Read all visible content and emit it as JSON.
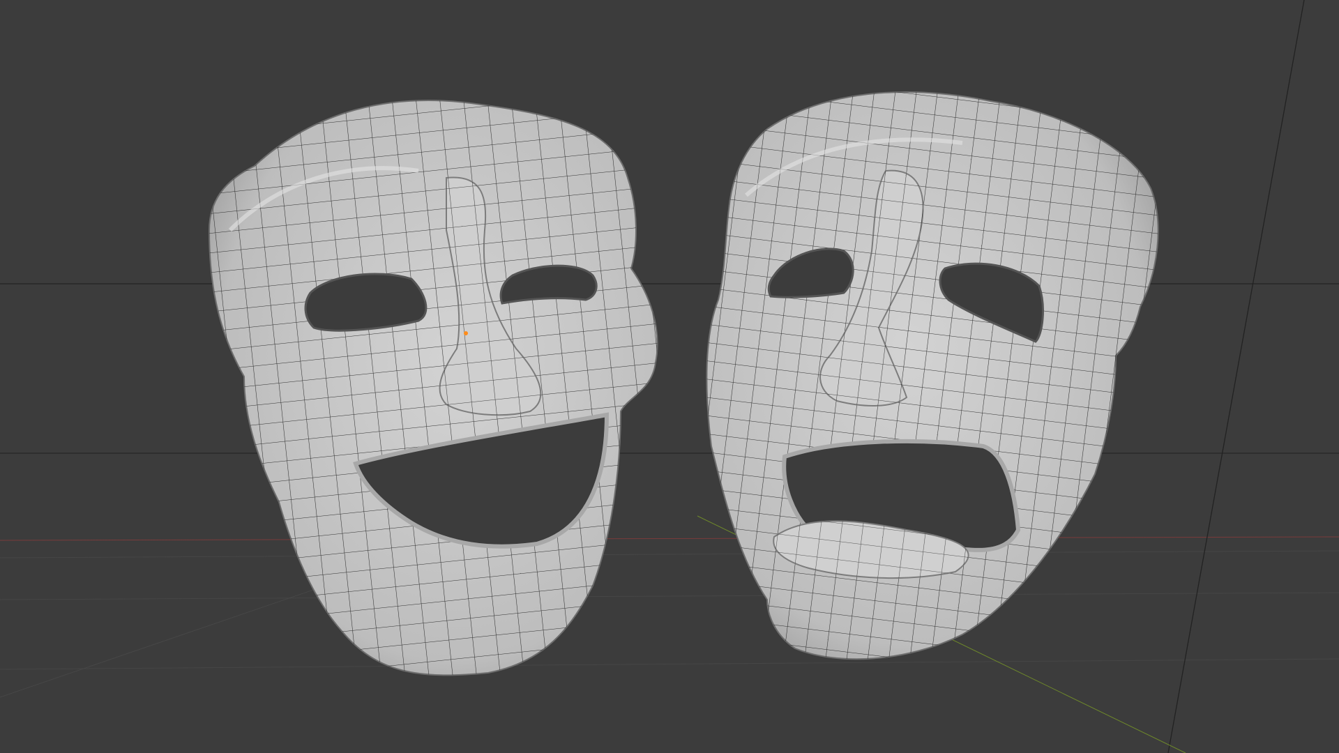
{
  "viewport": {
    "background_color": "#3c3c3c",
    "grid_color": "#4a4a4a",
    "x_axis_color": "#8a3a3a",
    "y_axis_color": "#6f8a2a"
  },
  "objects": [
    {
      "name": "comedy-mask",
      "expression": "smiling",
      "color": "#c9c9c9",
      "wire_color": "#1e1e1e"
    },
    {
      "name": "tragedy-mask",
      "expression": "frowning",
      "color": "#c9c9c9",
      "wire_color": "#1e1e1e"
    }
  ]
}
